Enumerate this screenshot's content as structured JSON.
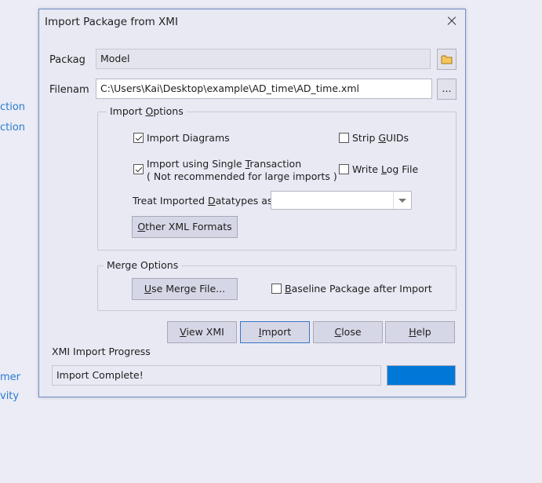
{
  "background": {
    "links": [
      "ction",
      "ction",
      "mer",
      "vity"
    ]
  },
  "dialog": {
    "title": "Import Package from XMI",
    "package_label": "Packag",
    "package_value": "Model",
    "filename_label": "Filenam",
    "filename_value": "C:\\Users\\Kai\\Desktop\\example\\AD_time\\AD_time.xml",
    "browse_label": "...",
    "import_options": {
      "legend_pre": "Import ",
      "legend_u": "O",
      "legend_post": "ptions",
      "import_diagrams": "Import Diagrams",
      "single_tx_pre": "Import using Single ",
      "single_tx_u": "T",
      "single_tx_post": "ransaction",
      "single_tx_note": "( Not recommended for large imports )",
      "strip_pre": "Strip ",
      "strip_u": "G",
      "strip_post": "UIDs",
      "writelog_pre": "Write ",
      "writelog_u": "L",
      "writelog_post": "og File",
      "datatypes_pre": "Treat Imported ",
      "datatypes_u": "D",
      "datatypes_post": "atatypes as",
      "datatypes_value": "",
      "other_u": "O",
      "other_post": "ther XML Formats"
    },
    "merge_options": {
      "legend": "Merge Options",
      "merge_u": "U",
      "merge_post": "se Merge File...",
      "baseline_u": "B",
      "baseline_post": "aseline Package after Import"
    },
    "buttons": {
      "view_u": "V",
      "view_post": "iew XMI",
      "import_u": "I",
      "import_post": "mport",
      "close_u": "C",
      "close_post": "lose",
      "help_u": "H",
      "help_post": "elp"
    },
    "progress_label": "XMI Import Progress",
    "progress_text": "Import Complete!",
    "progress_fraction": 1.0,
    "progress_color": "#0078d7"
  }
}
